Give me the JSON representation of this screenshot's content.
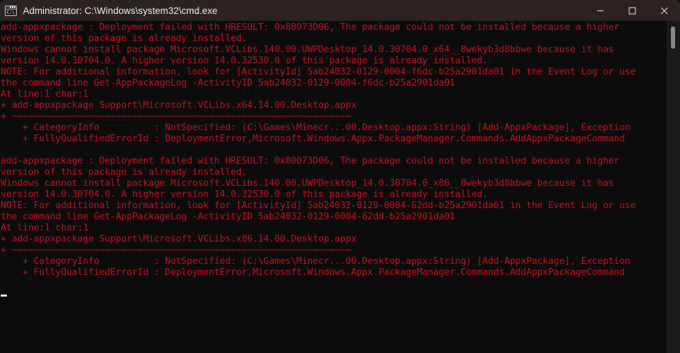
{
  "window": {
    "title": "Administrator: C:\\Windows\\system32\\cmd.exe",
    "icon_name": "cmd-icon",
    "icon_prompt": "C:\\",
    "background_color": "#0c0c0c",
    "titlebar_color": "#2b2321",
    "text_color": "#c50f1f",
    "cursor_color": "#e8e8e8"
  },
  "controls": {
    "minimize_label": "Minimize",
    "maximize_label": "Maximize",
    "close_label": "Close"
  },
  "scrollbar": {
    "track_color": "#1a1a1a",
    "thumb_color": "#8a8a8a"
  },
  "console": {
    "lines": [
      "add-appxpackage : Deployment failed with HRESULT: 0x80073D06, The package could not be installed because a higher",
      "version of this package is already installed.",
      "Windows cannot install package Microsoft.VCLibs.140.00.UWPDesktop_14.0.30704.0_x64__8wekyb3d8bbwe because it has",
      "version 14.0.30704.0. A higher version 14.0.32530.0 of this package is already installed.",
      "NOTE: For additional information, look for [ActivityId] 5ab24032-0129-0004-f6dc-b25a2901da01 in the Event Log or use",
      "the command line Get-AppPackageLog -ActivityID 5ab24032-0129-0004-f6dc-b25a2901da01",
      "At line:1 char:1",
      "+ add-appxpackage Support\\Microsoft.VCLibs.x64.14.00.Desktop.appx",
      "+ ~~~~~~~~~~~~~~~~~~~~~~~~~~~~~~~~~~~~~~~~~~~~~~~~~~~~~~~~~~~~~~",
      "    + CategoryInfo          : NotSpecified: (C:\\Games\\Minecr...00.Desktop.appx:String) [Add-AppxPackage], Exception",
      "    + FullyQualifiedErrorId : DeploymentError,Microsoft.Windows.Appx.PackageManager.Commands.AddAppxPackageCommand",
      "",
      "add-appxpackage : Deployment failed with HRESULT: 0x80073D06, The package could not be installed because a higher",
      "version of this package is already installed.",
      "Windows cannot install package Microsoft.VCLibs.140.00.UWPDesktop_14.0.30704.0_x86__8wekyb3d8bbwe because it has",
      "version 14.0.30704.0. A higher version 14.0.32530.0 of this package is already installed.",
      "NOTE: For additional information, look for [ActivityId] 5ab24032-0129-0004-62dd-b25a2901da01 in the Event Log or use",
      "the command line Get-AppPackageLog -ActivityID 5ab24032-0129-0004-62dd-b25a2901da01",
      "At line:1 char:1",
      "+ add-appxpackage Support\\Microsoft.VCLibs.x86.14.00.Desktop.appx",
      "+ ~~~~~~~~~~~~~~~~~~~~~~~~~~~~~~~~~~~~~~~~~~~~~~~~~~~~~~~~~~~~~~",
      "    + CategoryInfo          : NotSpecified: (C:\\Games\\Minecr...00.Desktop.appx:String) [Add-AppxPackage], Exception",
      "    + FullyQualifiedErrorId : DeploymentError,Microsoft.Windows.Appx.PackageManager.Commands.AddAppxPackageCommand",
      "",
      ""
    ],
    "cursor_line_index": 24
  }
}
